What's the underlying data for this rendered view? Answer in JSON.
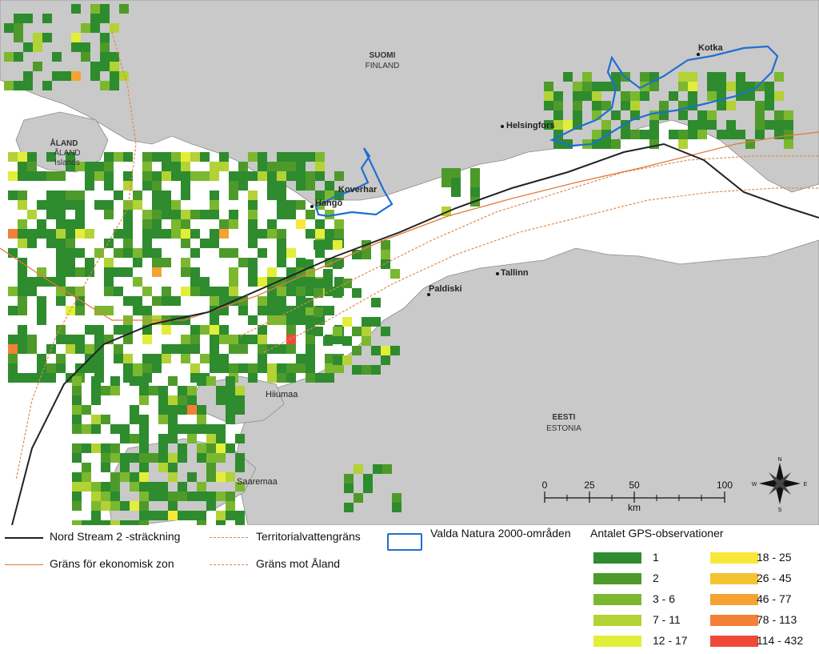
{
  "countries": {
    "finland_main": "SUOMI",
    "finland_sub": "FINLAND",
    "aland_main": "ÅLAND",
    "aland_sub1": "ÅLAND",
    "aland_sub2": "Islands",
    "estonia_main": "EESTI",
    "estonia_sub": "ESTONIA"
  },
  "places": {
    "kotka": "Kotka",
    "helsingfors": "Helsingfors",
    "koverhar": "Koverhar",
    "hango": "Hangö",
    "tallinn": "Tallinn",
    "paldiski": "Paldiski",
    "hiiumaa": "Hiiumaa",
    "saaremaa": "Saaremaa"
  },
  "scale_bar": {
    "ticks": [
      "0",
      "25",
      "50",
      "100"
    ],
    "unit": "km"
  },
  "compass": {
    "n": "N",
    "s": "S",
    "e": "E",
    "w": "W"
  },
  "legend": {
    "nord_stream": "Nord Stream 2 -sträckning",
    "ekonomisk_zon": "Gräns för ekonomisk zon",
    "territorial": "Territorialvattengräns",
    "aland_border": "Gräns mot Åland",
    "natura": "Valda Natura 2000-områden",
    "gps_title": "Antalet GPS-observationer",
    "gps_classes": [
      {
        "label": "1",
        "color": "#2e8b2e"
      },
      {
        "label": "2",
        "color": "#4d9a2a"
      },
      {
        "label": "3 - 6",
        "color": "#7bb82f"
      },
      {
        "label": "7 - 11",
        "color": "#b2d235"
      },
      {
        "label": "12 - 17",
        "color": "#e3ee3b"
      },
      {
        "label": "18 - 25",
        "color": "#f7e83a"
      },
      {
        "label": "26 - 45",
        "color": "#f5c233"
      },
      {
        "label": "46 - 77",
        "color": "#f4a334"
      },
      {
        "label": "78 - 113",
        "color": "#f28036"
      },
      {
        "label": "114 - 432",
        "color": "#ee4a3a"
      }
    ]
  },
  "colors": {
    "land": "#c8c8c8",
    "sea": "#ffffff",
    "route": "#222222",
    "ez_border": "#e07b39",
    "territorial": "#e08a4a",
    "natura": "#1f6fd0"
  }
}
